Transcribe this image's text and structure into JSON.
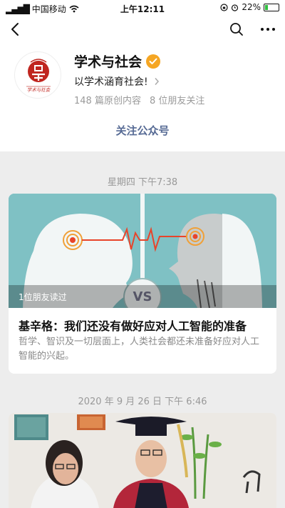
{
  "status_bar": {
    "carrier": "中国移动",
    "time": "上午12:11",
    "battery": "22%",
    "battery_level": 0.22
  },
  "account": {
    "name": "学术与社会",
    "slogan": "以学术涵育社会!",
    "original_count": "148 篇原创内容",
    "friends_follow": "8 位朋友关注",
    "follow_button": "关注公众号",
    "logo_caption": "学术与社会"
  },
  "feed": [
    {
      "date": "星期四 下午7:38",
      "readers": "1位朋友读过",
      "vs_label": "VS",
      "title": "基辛格：我们还没有做好应对人工智能的准备",
      "summary": "哲学、智识及一切层面上，人类社会都还未准备好应对人工智能的兴起。"
    },
    {
      "date": "2020 年 9 月 26 日 下午 6:46"
    }
  ],
  "colors": {
    "link": "#576b95",
    "verified": "#f5a623",
    "cover_teal": "#7fc1c4",
    "logo_red": "#c0251f"
  }
}
